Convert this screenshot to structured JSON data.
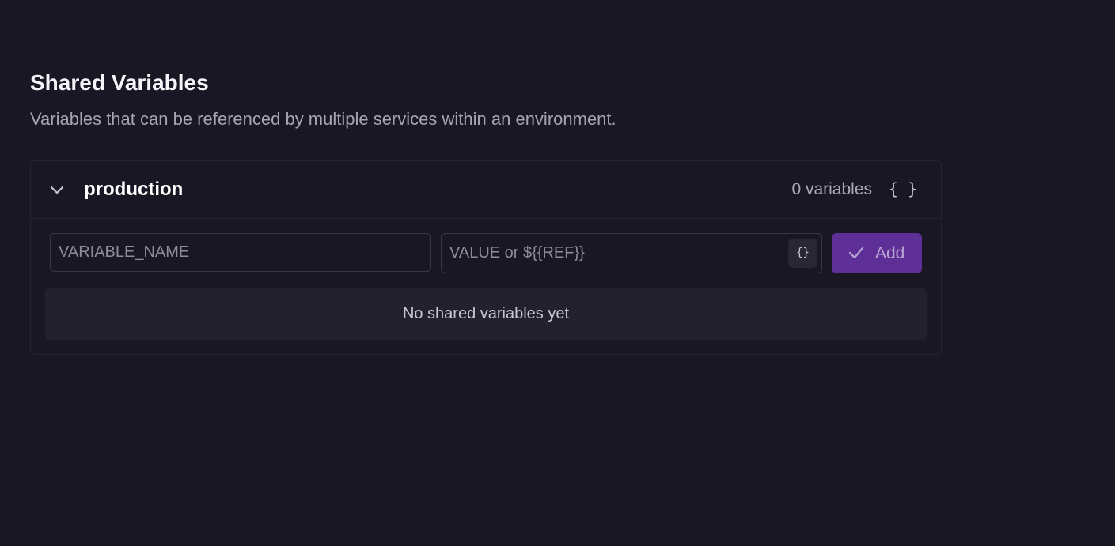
{
  "header": {
    "title": "Shared Variables",
    "subtitle": "Variables that can be referenced by multiple services within an environment."
  },
  "environment": {
    "name": "production",
    "count_label": "0 variables",
    "header_icon": "braces-icon",
    "expanded": true
  },
  "form": {
    "name_placeholder": "VARIABLE_NAME",
    "value_placeholder": "VALUE or ${{REF}}",
    "ref_button_icon": "braces-icon",
    "add_label": "Add"
  },
  "empty_state": {
    "message": "No shared variables yet"
  },
  "colors": {
    "background": "#1a1724",
    "accent": "#5e2f96",
    "muted_text": "#a7a3b3"
  }
}
